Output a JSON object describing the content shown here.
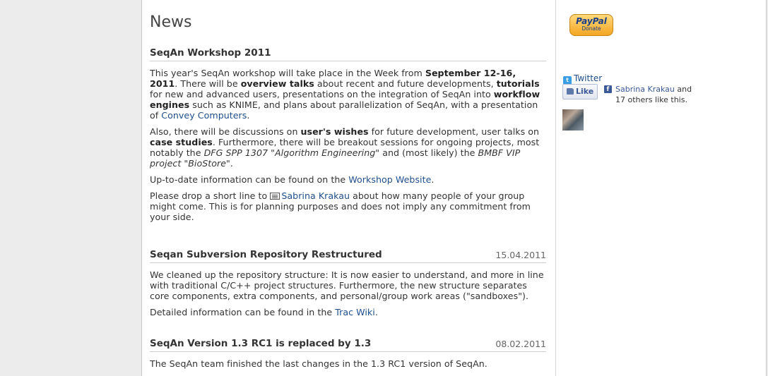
{
  "page_title": "News",
  "articles": [
    {
      "title": "SeqAn Workshop 2011",
      "date": "",
      "paragraphs": {
        "p1": {
          "t1": "This year's SeqAn workshop will take place in the Week from ",
          "b1": "September 12-16, 2011",
          "t2": ". There will be ",
          "b2": "overview talks",
          "t3": " about recent and future developments, ",
          "b3": "tutorials",
          "t4": " for new and advanced users, presentations on the integration of SeqAn into ",
          "b4": "workflow engines",
          "t5": " such as KNIME, and plans about parallelization of SeqAn, with a presentation of ",
          "link": "Convey Computers",
          "t6": "."
        },
        "p2": {
          "t1": "Also, there will be discussions on ",
          "b1": "user's wishes",
          "t2": " for future development, user talks on ",
          "b2": "case studies",
          "t3": ". Furthermore, there will be breakout sessions for ongoing projects, most notably the ",
          "i1": "DFG SPP 1307 \"Algorithm Engineering\"",
          "t4": " and (most likely) the ",
          "i2": "BMBF VIP project \"BioStore\"",
          "t5": "."
        },
        "p3": {
          "t1": "Up-to-date information can be found on the ",
          "link": "Workshop Website",
          "t2": "."
        },
        "p4": {
          "t1": "Please drop a short line to ",
          "mail_icon": "mail-icon",
          "link": "Sabrina Krakau",
          "t2": " about how many people of your group might come. This is for planning purposes and does not imply any commitment from your side."
        }
      }
    },
    {
      "title": "Seqan Subversion Repository Restructured",
      "date": "15.04.2011",
      "paragraphs": {
        "p1": {
          "t1": "We cleaned up the repository structure: It is now easier to understand, and more in line with traditional C/C++ project structures. Furthermore, the new structure separates core components, extra components, and personal/group work areas (\"sandboxes\")."
        },
        "p2": {
          "t1": "Detailed information can be found in the ",
          "link": "Trac Wiki",
          "t2": "."
        }
      }
    },
    {
      "title": "SeqAn Version 1.3 RC1 is replaced by 1.3",
      "date": "08.02.2011",
      "paragraphs": {
        "p1": {
          "t1": "The SeqAn team finished the last changes in the 1.3 RC1 version of SeqAn."
        }
      }
    }
  ],
  "sidebar": {
    "paypal": {
      "logo": "PayPal",
      "label": "Donate"
    },
    "twitter": {
      "icon": "twitter-icon",
      "label": "Twitter"
    },
    "facebook": {
      "like_label": "Like",
      "icon": "facebook-icon",
      "liker_name": "Sabrina Krakau",
      "liker_suffix": " and 17 others like this."
    }
  },
  "colors": {
    "link": "#1f4e8c",
    "facebook": "#3b5998",
    "paypal_gold": "#f5a623",
    "page_bg": "#ececec"
  }
}
